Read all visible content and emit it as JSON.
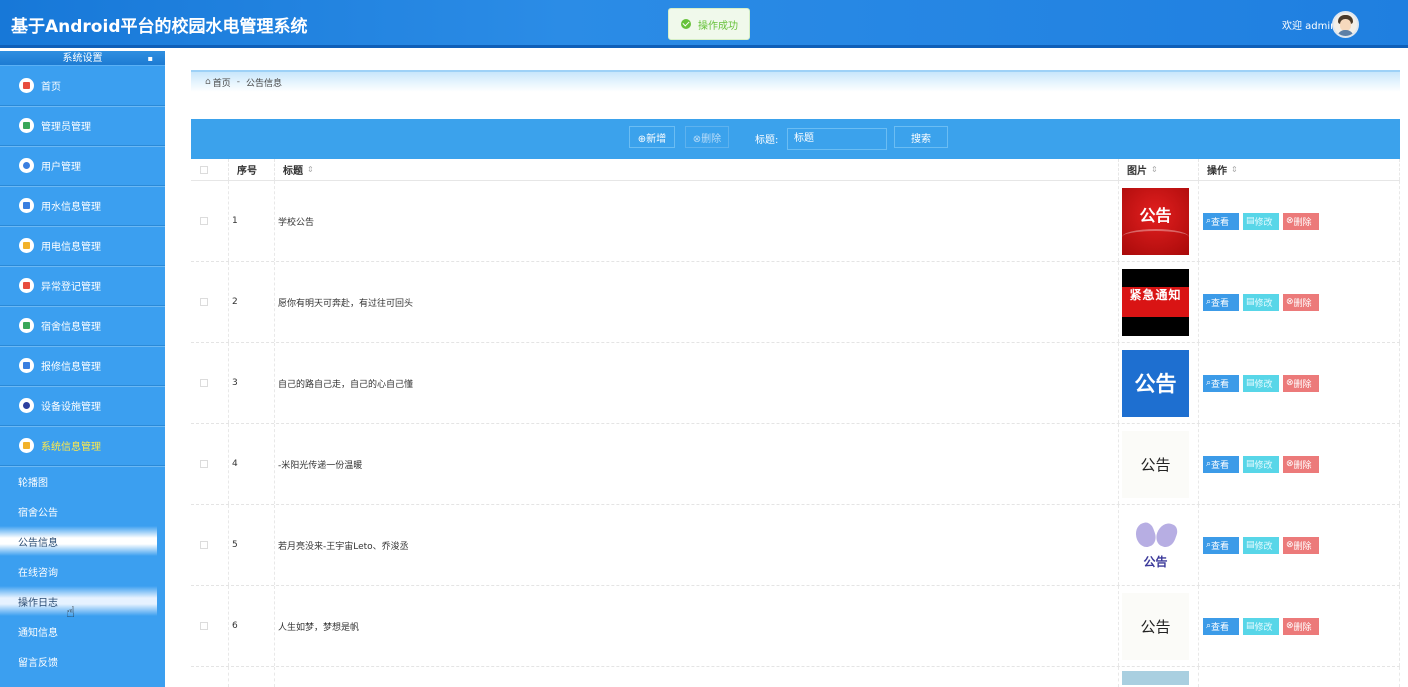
{
  "header": {
    "app_title": "基于Android平台的校园水电管理系统",
    "toast": "操作成功",
    "welcome": "欢迎 admin"
  },
  "sidebar": {
    "section_title": "系统设置",
    "items": [
      {
        "label": "首页",
        "icon": "home-icon",
        "color": "#e84c3d"
      },
      {
        "label": "管理员管理",
        "icon": "admin-icon",
        "color": "#3aa75a"
      },
      {
        "label": "用户管理",
        "icon": "user-icon",
        "color": "#3b7fe0"
      },
      {
        "label": "用水信息管理",
        "icon": "water-icon",
        "color": "#3b7fe0"
      },
      {
        "label": "用电信息管理",
        "icon": "power-icon",
        "color": "#f2b22a"
      },
      {
        "label": "异常登记管理",
        "icon": "warning-icon",
        "color": "#e84c3d"
      },
      {
        "label": "宿舍信息管理",
        "icon": "dorm-icon",
        "color": "#3aa75a"
      },
      {
        "label": "报修信息管理",
        "icon": "repair-icon",
        "color": "#3b7fe0"
      },
      {
        "label": "设备设施管理",
        "icon": "device-icon",
        "color": "#2d3f9e"
      },
      {
        "label": "系统信息管理",
        "icon": "system-icon",
        "color": "#f2b22a"
      }
    ],
    "sub_items": [
      {
        "label": "轮播图"
      },
      {
        "label": "宿舍公告"
      },
      {
        "label": "公告信息"
      },
      {
        "label": "在线咨询"
      },
      {
        "label": "操作日志"
      },
      {
        "label": "通知信息"
      },
      {
        "label": "留言反馈"
      }
    ]
  },
  "breadcrumb": {
    "home": "首页",
    "separator": "-",
    "current": "公告信息"
  },
  "toolbar": {
    "add_label": "⊕新增",
    "delete_label": "⊗删除",
    "search_label": "标题:",
    "search_value": "标题",
    "search_button": "搜索"
  },
  "table": {
    "headers": {
      "no": "序号",
      "title": "标题",
      "image": "图片",
      "ops": "操作"
    },
    "ops": {
      "view": "查看",
      "edit": "修改",
      "delete": "删除"
    },
    "rows": [
      {
        "no": "1",
        "title": "学校公告",
        "image_text": "公告",
        "image_style": "red"
      },
      {
        "no": "2",
        "title": "愿你有明天可奔赴，有过往可回头",
        "image_text": "紧急通知",
        "image_style": "urgent"
      },
      {
        "no": "3",
        "title": "自己的路自己走，自己的心自己懂",
        "image_text": "公告",
        "image_style": "blue"
      },
      {
        "no": "4",
        "title": "-米阳光传递一份温暖",
        "image_text": "公告",
        "image_style": "plain"
      },
      {
        "no": "5",
        "title": "若月亮没来-王宇宙Leto、乔浚丞",
        "image_text": "公告",
        "image_style": "butterfly"
      },
      {
        "no": "6",
        "title": "人生如梦，梦想是帆",
        "image_text": "公告",
        "image_style": "plain"
      }
    ]
  }
}
